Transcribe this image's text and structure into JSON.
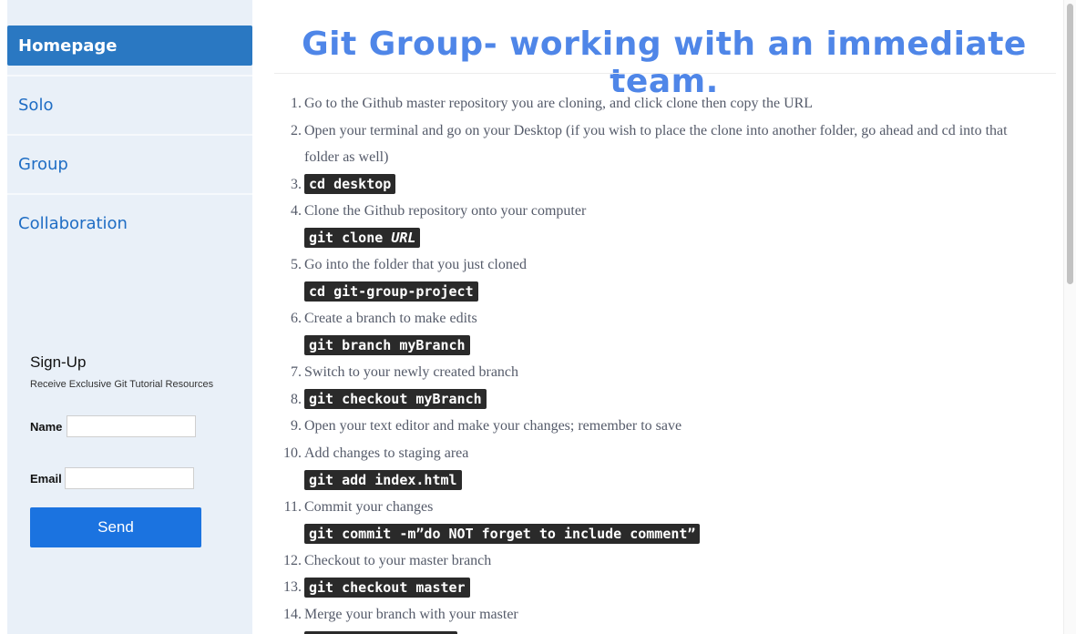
{
  "sidebar": {
    "items": [
      {
        "label": "Homepage",
        "active": true
      },
      {
        "label": "Solo",
        "active": false
      },
      {
        "label": "Group",
        "active": false
      },
      {
        "label": "Collaboration",
        "active": false
      }
    ],
    "signup": {
      "title": "Sign-Up",
      "subtitle": "Receive Exclusive Git Tutorial Resources",
      "name_label": "Name",
      "name_value": "",
      "email_label": "Email",
      "email_value": "",
      "send_label": "Send"
    }
  },
  "main": {
    "title": "Git Group- working with an immediate team.",
    "steps": [
      {
        "num": "1.",
        "text": "Go to the Github master repository you are cloning, and click clone then copy the URL"
      },
      {
        "num": "2.",
        "text": "Open your terminal and go on your Desktop (if you wish to place the clone into another folder, go ahead and cd into that folder as well)"
      },
      {
        "num": "3.",
        "code": "cd desktop"
      },
      {
        "num": "4.",
        "text": "Clone the Github repository onto your computer",
        "code_prefix": "git clone ",
        "code_italic": "URL"
      },
      {
        "num": "5.",
        "text": "Go into the folder that you just cloned",
        "code": "cd git-group-project"
      },
      {
        "num": "6.",
        "text": "Create a branch to make edits",
        "code": "git branch myBranch"
      },
      {
        "num": "7.",
        "text": "Switch to your newly created branch"
      },
      {
        "num": "8.",
        "code": "git checkout myBranch"
      },
      {
        "num": "9.",
        "text": "Open your text editor and make your changes; remember to save"
      },
      {
        "num": "10.",
        "text": "Add changes to staging area",
        "code": "git add index.html"
      },
      {
        "num": "11.",
        "text": "Commit your changes",
        "code": "git commit -m”do NOT forget to include comment”"
      },
      {
        "num": "12.",
        "text": "Checkout to your master branch"
      },
      {
        "num": "13.",
        "code": "git checkout master"
      },
      {
        "num": "14.",
        "text": "Merge your branch with your master"
      }
    ]
  },
  "colors": {
    "accent": "#2a78c2",
    "title": "#4f86e8",
    "send_button": "#1b73e0",
    "sidebar_bg": "#e9f0f8",
    "code_bg": "#2a2a2a"
  }
}
